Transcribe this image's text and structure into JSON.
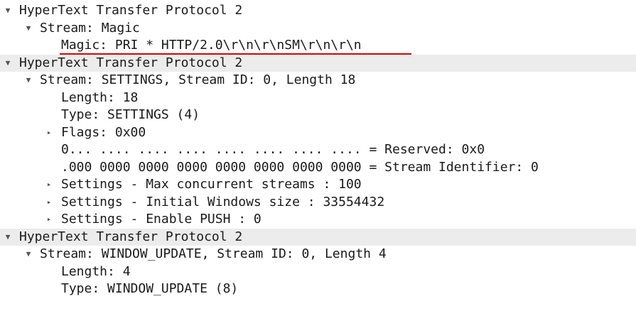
{
  "packet_details": {
    "sections": [
      {
        "header": "HyperText Transfer Protocol 2",
        "stream": {
          "label": "Stream: Magic",
          "fields": [
            {
              "text": "Magic: PRI * HTTP/2.0\\r\\n\\r\\nSM\\r\\n\\r\\n"
            }
          ]
        }
      },
      {
        "header": "HyperText Transfer Protocol 2",
        "stream": {
          "label": "Stream: SETTINGS, Stream ID: 0, Length 18",
          "fields": [
            {
              "text": "Length: 18"
            },
            {
              "text": "Type: SETTINGS (4)"
            },
            {
              "text": "Flags: 0x00"
            },
            {
              "text": "0... .... .... .... .... .... .... .... = Reserved: 0x0"
            },
            {
              "text": ".000 0000 0000 0000 0000 0000 0000 0000 = Stream Identifier: 0"
            },
            {
              "text": "Settings - Max concurrent streams : 100"
            },
            {
              "text": "Settings - Initial Windows size : 33554432"
            },
            {
              "text": "Settings - Enable PUSH : 0"
            }
          ]
        }
      },
      {
        "header": "HyperText Transfer Protocol 2",
        "stream": {
          "label": "Stream: WINDOW_UPDATE, Stream ID: 0, Length 4",
          "fields": [
            {
              "text": "Length: 4"
            },
            {
              "text": "Type: WINDOW_UPDATE (8)"
            }
          ]
        }
      }
    ]
  },
  "icons": {
    "expanded": "chevron-down-icon",
    "collapsed": "chevron-right-icon"
  },
  "colors": {
    "highlight_underline": "#e00000",
    "header_shade": "#ececec",
    "text": "#1a1a1a"
  }
}
